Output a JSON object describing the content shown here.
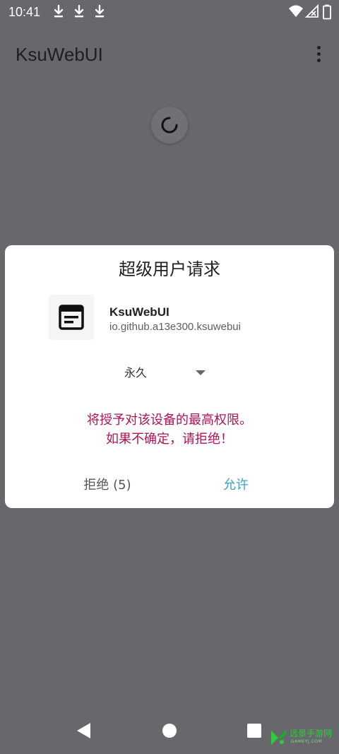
{
  "status_bar": {
    "time": "10:41",
    "notification_icons": [
      "download-icon",
      "download-icon",
      "download-icon"
    ],
    "system_icons": [
      "wifi-icon",
      "no-signal-icon",
      "battery-icon"
    ]
  },
  "app_bar": {
    "title": "KsuWebUI",
    "menu_icon": "more-vert-icon"
  },
  "loading": {
    "icon": "progress-spinner-icon"
  },
  "dialog": {
    "title": "超级用户请求",
    "app_icon": "notes-icon",
    "app_name": "KsuWebUI",
    "package_name": "io.github.a13e300.ksuwebui",
    "duration_selected": "永久",
    "warning_line1": "将授予对该设备的最高权限。",
    "warning_line2": "如果不确定，请拒绝！",
    "deny_label": "拒绝 (5)",
    "allow_label": "允许",
    "colors": {
      "warning": "#ad1457",
      "allow": "#3ea0cf",
      "deny": "#555555"
    }
  },
  "nav_bar": {
    "back": "back-icon",
    "home": "home-icon",
    "recents": "recents-icon"
  },
  "watermark": {
    "text": "远景手游网",
    "subtext": "GAMEYJ.COM"
  }
}
